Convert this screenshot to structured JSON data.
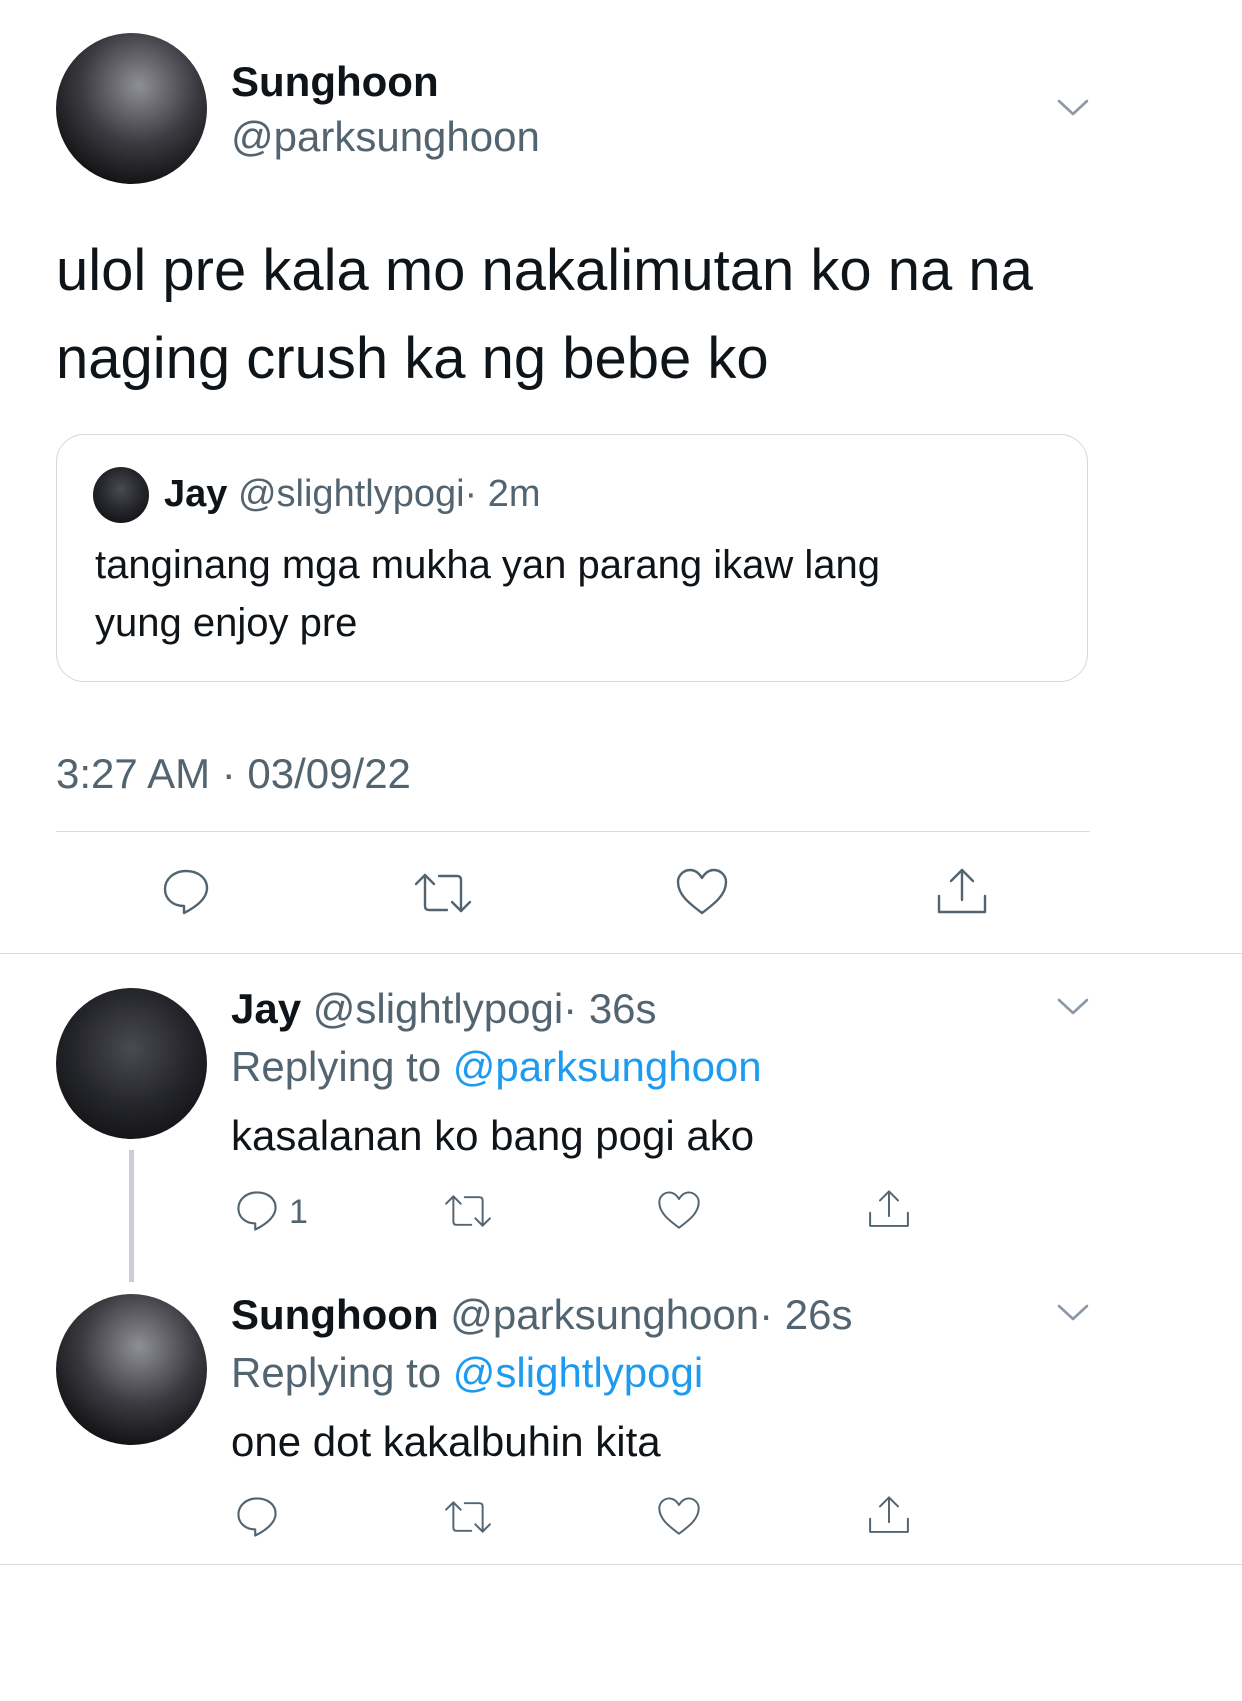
{
  "main_tweet": {
    "name": "Sunghoon",
    "handle": "@parksunghoon",
    "text_line1": "ulol pre kala mo nakalimutan ko na na",
    "text_line2": "naging crush ka ng bebe ko",
    "timestamp": "3:27 AM · 03/09/22"
  },
  "quoted_tweet": {
    "name": "Jay",
    "handle": "@slightlypogi",
    "time": "· 2m",
    "text_line1": "tanginang mga mukha yan parang ikaw lang",
    "text_line2": "yung enjoy pre"
  },
  "replies": [
    {
      "name": "Jay",
      "handle": "@slightlypogi",
      "time": "· 36s",
      "replying_prefix": "Replying to",
      "replying_handle": "@parksunghoon",
      "text": "kasalanan ko bang pogi ako",
      "reply_count": "1"
    },
    {
      "name": "Sunghoon",
      "handle": "@parksunghoon",
      "time": "· 26s",
      "replying_prefix": "Replying to",
      "replying_handle": "@slightlypogi",
      "text": "one dot kakalbuhin kita",
      "reply_count": ""
    }
  ],
  "icons": [
    "chevron-down-icon",
    "reply-icon",
    "retweet-icon",
    "like-icon",
    "share-icon"
  ],
  "colors": {
    "text": "#0f1419",
    "muted": "#536471",
    "link": "#1d9bf0",
    "divider": "#d9dde1"
  }
}
